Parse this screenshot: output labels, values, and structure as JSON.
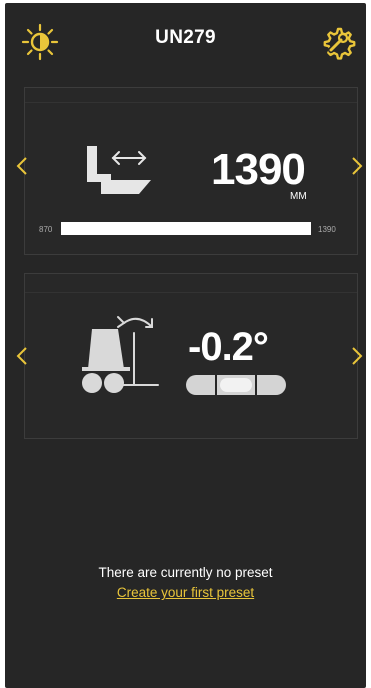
{
  "header": {
    "title": "UN279",
    "left_icon": "brightness-icon",
    "right_icon": "settings-wrench-icon"
  },
  "width_panel": {
    "icon": "boom-width-icon",
    "value": "1390",
    "unit": "MM",
    "range_min": "870",
    "range_max": "1390",
    "fill_fraction": 1.0
  },
  "tilt_panel": {
    "icon": "machine-tilt-icon",
    "value": "-0.2°",
    "level_icon": "spirit-level-icon"
  },
  "empty_state": {
    "message": "There are currently no preset",
    "link": "Create your first preset"
  },
  "colors": {
    "background": "#262626",
    "accent": "#e9c53a",
    "text": "#ffffff"
  }
}
